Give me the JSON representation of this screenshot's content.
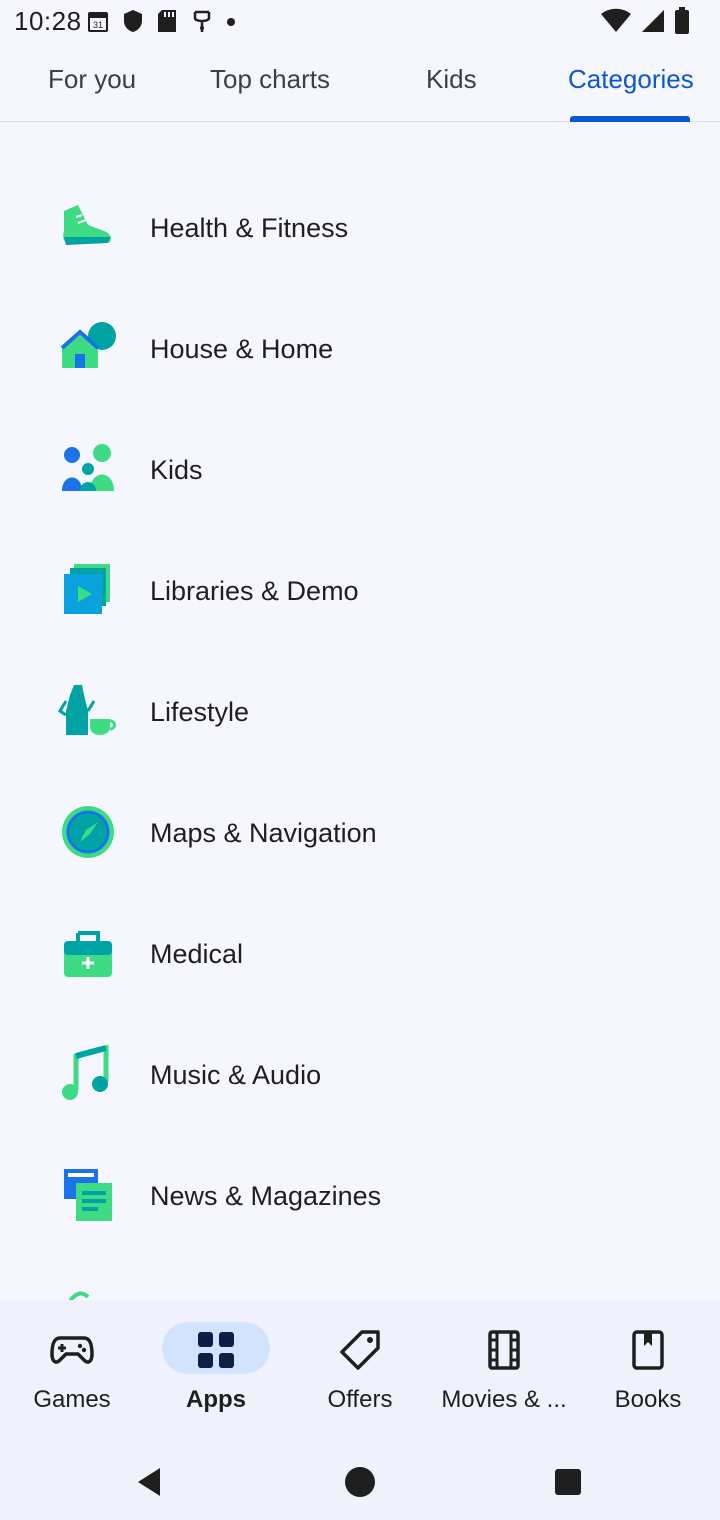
{
  "status_bar": {
    "time": "10:28",
    "calendar_day": "31",
    "icons": [
      "calendar-icon",
      "shield-icon",
      "sd-card-icon",
      "usb-icon",
      "dot-icon",
      "wifi-icon",
      "signal-icon",
      "battery-icon"
    ]
  },
  "top_tabs": [
    {
      "label": "For you",
      "active": false
    },
    {
      "label": "Top charts",
      "active": false
    },
    {
      "label": "Kids",
      "active": false
    },
    {
      "label": "Categories",
      "active": true
    }
  ],
  "categories": [
    {
      "label": "Health & Fitness",
      "icon": "sneaker-icon"
    },
    {
      "label": "House & Home",
      "icon": "house-icon"
    },
    {
      "label": "Kids",
      "icon": "family-icon"
    },
    {
      "label": "Libraries & Demo",
      "icon": "play-stack-icon"
    },
    {
      "label": "Lifestyle",
      "icon": "coffee-pot-icon"
    },
    {
      "label": "Maps & Navigation",
      "icon": "compass-icon"
    },
    {
      "label": "Medical",
      "icon": "medical-kit-icon"
    },
    {
      "label": "Music & Audio",
      "icon": "music-note-icon"
    },
    {
      "label": "News & Magazines",
      "icon": "newspaper-icon"
    }
  ],
  "bottom_nav": [
    {
      "label": "Games",
      "icon": "gamepad-icon",
      "active": false
    },
    {
      "label": "Apps",
      "icon": "apps-grid-icon",
      "active": true
    },
    {
      "label": "Offers",
      "icon": "tag-icon",
      "active": false
    },
    {
      "label": "Movies & ...",
      "icon": "film-icon",
      "active": false
    },
    {
      "label": "Books",
      "icon": "bookmark-icon",
      "active": false
    }
  ],
  "colors": {
    "accent": "#0b57d0",
    "active_pill": "#d3e3fd",
    "background": "#f6f7fe",
    "icon_green": "#3ddc84",
    "icon_teal": "#00a3a3",
    "icon_blue": "#1a73e8"
  }
}
